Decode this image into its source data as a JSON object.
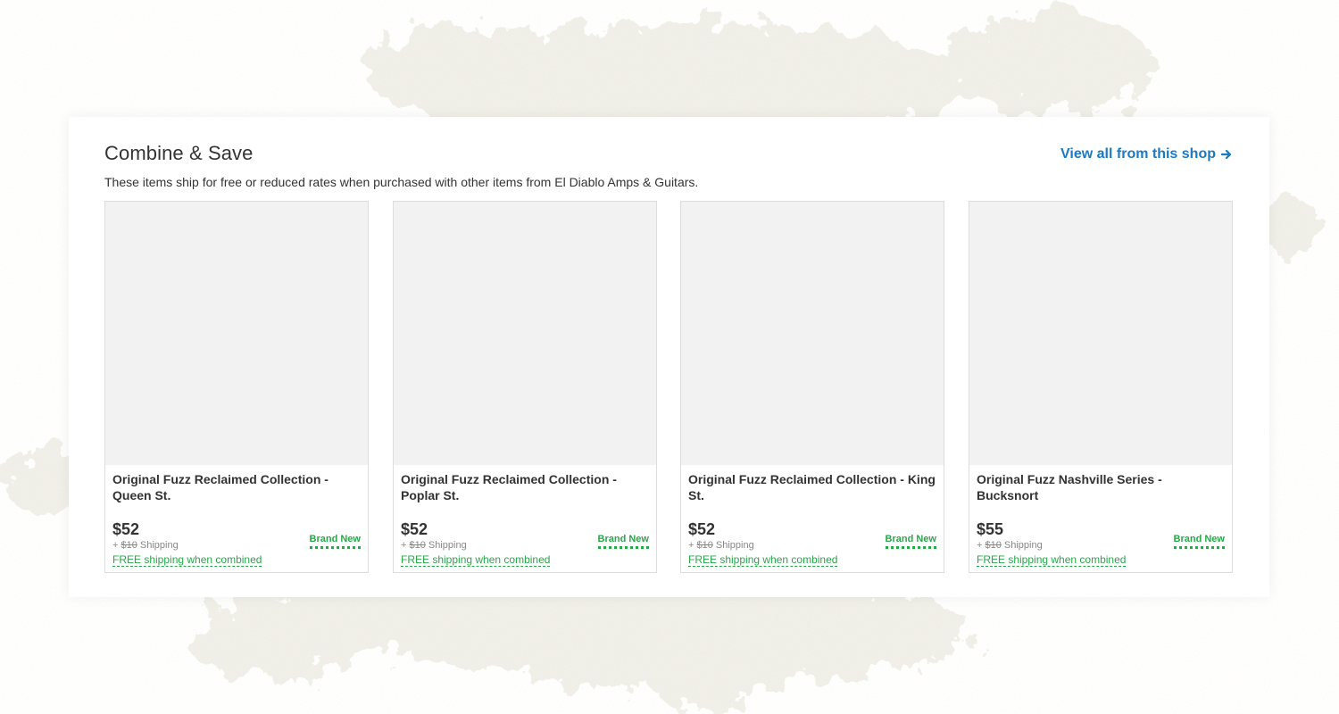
{
  "section": {
    "title": "Combine & Save",
    "subtitle": "These items ship for free or reduced rates when purchased with other items from El Diablo Amps & Guitars.",
    "view_all_label": "View all from this shop"
  },
  "colors": {
    "link": "#1a7ac4",
    "accent_green": "#29a84a",
    "thumb_placeholder": "#f2f2f2"
  },
  "icons": {
    "view_all": "arrow-right-icon"
  },
  "products": [
    {
      "title": "Original Fuzz Reclaimed Collection - Queen St.",
      "price": "$52",
      "shipping_prefix": "+ ",
      "shipping_amount": "$10",
      "shipping_suffix": " Shipping",
      "free_shipping": "FREE shipping when combined",
      "condition": "Brand New"
    },
    {
      "title": "Original Fuzz Reclaimed Collection - Poplar St.",
      "price": "$52",
      "shipping_prefix": "+ ",
      "shipping_amount": "$10",
      "shipping_suffix": " Shipping",
      "free_shipping": "FREE shipping when combined",
      "condition": "Brand New"
    },
    {
      "title": "Original Fuzz Reclaimed Collection - King St.",
      "price": "$52",
      "shipping_prefix": "+ ",
      "shipping_amount": "$10",
      "shipping_suffix": " Shipping",
      "free_shipping": "FREE shipping when combined",
      "condition": "Brand New"
    },
    {
      "title": "Original Fuzz Nashville Series - Bucksnort",
      "price": "$55",
      "shipping_prefix": "+ ",
      "shipping_amount": "$10",
      "shipping_suffix": " Shipping",
      "free_shipping": "FREE shipping when combined",
      "condition": "Brand New"
    }
  ]
}
